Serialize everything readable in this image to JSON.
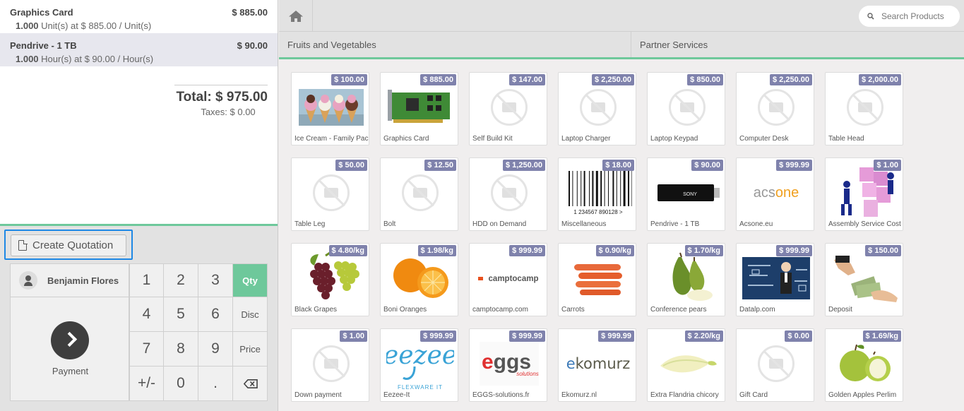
{
  "order": {
    "lines": [
      {
        "name": "Graphics Card",
        "price": "$ 885.00",
        "qty": "1.000",
        "detail": "Unit(s) at $ 885.00 / Unit(s)"
      },
      {
        "name": "Pendrive - 1 TB",
        "price": "$ 90.00",
        "qty": "1.000",
        "detail": "Hour(s) at $ 90.00 / Hour(s)"
      }
    ],
    "total": "Total: $ 975.00",
    "taxes": "Taxes: $ 0.00"
  },
  "control": {
    "create_quotation": "Create Quotation",
    "customer": "Benjamin Flores",
    "payment": "Payment",
    "keys": [
      "1",
      "2",
      "3",
      "Qty",
      "4",
      "5",
      "6",
      "Disc",
      "7",
      "8",
      "9",
      "Price",
      "+/-",
      "0",
      "."
    ],
    "active_mode": "Qty"
  },
  "topbar": {
    "search_placeholder": "Search Products"
  },
  "categories": [
    "Fruits and Vegetables",
    "Partner Services"
  ],
  "products": [
    {
      "name": "Ice Cream - Family Pack",
      "price": "$ 100.00",
      "img": "ice-cream"
    },
    {
      "name": "Graphics Card",
      "price": "$ 885.00",
      "img": "graphics-card"
    },
    {
      "name": "Self Build Kit",
      "price": "$ 147.00",
      "img": "none"
    },
    {
      "name": "Laptop Charger",
      "price": "$ 2,250.00",
      "img": "none"
    },
    {
      "name": "Laptop Keypad",
      "price": "$ 850.00",
      "img": "none"
    },
    {
      "name": "Computer Desk",
      "price": "$ 2,250.00",
      "img": "none"
    },
    {
      "name": "Table Head",
      "price": "$ 2,000.00",
      "img": "none"
    },
    {
      "name": "Table Leg",
      "price": "$ 50.00",
      "img": "none"
    },
    {
      "name": "Bolt",
      "price": "$ 12.50",
      "img": "none"
    },
    {
      "name": "HDD on Demand",
      "price": "$ 1,250.00",
      "img": "none"
    },
    {
      "name": "Miscellaneous",
      "price": "$ 18.00",
      "img": "barcode",
      "barcode_text": "1 234567 890128 >"
    },
    {
      "name": "Pendrive - 1 TB",
      "price": "$ 90.00",
      "img": "pendrive",
      "logo_text": "SONY"
    },
    {
      "name": "Acsone.eu",
      "price": "$ 999.99",
      "img": "acsone",
      "logo_text": "acsone"
    },
    {
      "name": "Assembly Service Cost",
      "price": "$ 1.00",
      "img": "assembly"
    },
    {
      "name": "Black Grapes",
      "price": "$ 4.80/kg",
      "img": "grapes"
    },
    {
      "name": "Boni Oranges",
      "price": "$ 1.98/kg",
      "img": "oranges"
    },
    {
      "name": "camptocamp.com",
      "price": "$ 999.99",
      "img": "camptocamp",
      "logo_text": "camptocamp"
    },
    {
      "name": "Carrots",
      "price": "$ 0.90/kg",
      "img": "carrots"
    },
    {
      "name": "Conference pears",
      "price": "$ 1.70/kg",
      "img": "pears"
    },
    {
      "name": "Datalp.com",
      "price": "$ 999.99",
      "img": "datalp"
    },
    {
      "name": "Deposit",
      "price": "$ 150.00",
      "img": "deposit"
    },
    {
      "name": "Down payment",
      "price": "$ 1.00",
      "img": "none"
    },
    {
      "name": "Eezee-It",
      "price": "$ 999.99",
      "img": "eezee",
      "logo_text": "eezee",
      "logo_sub": "FLEXWARE IT"
    },
    {
      "name": "EGGS-solutions.fr",
      "price": "$ 999.99",
      "img": "eggs",
      "logo_text": "eggs",
      "logo_sub": "solutions"
    },
    {
      "name": "Ekomurz.nl",
      "price": "$ 999.99",
      "img": "ekomurz",
      "logo_text": "ekomurz"
    },
    {
      "name": "Extra Flandria chicory",
      "price": "$ 2.20/kg",
      "img": "chicory"
    },
    {
      "name": "Gift Card",
      "price": "$ 0.00",
      "img": "none"
    },
    {
      "name": "Golden Apples Perlim",
      "price": "$ 1.69/kg",
      "img": "apples"
    }
  ]
}
